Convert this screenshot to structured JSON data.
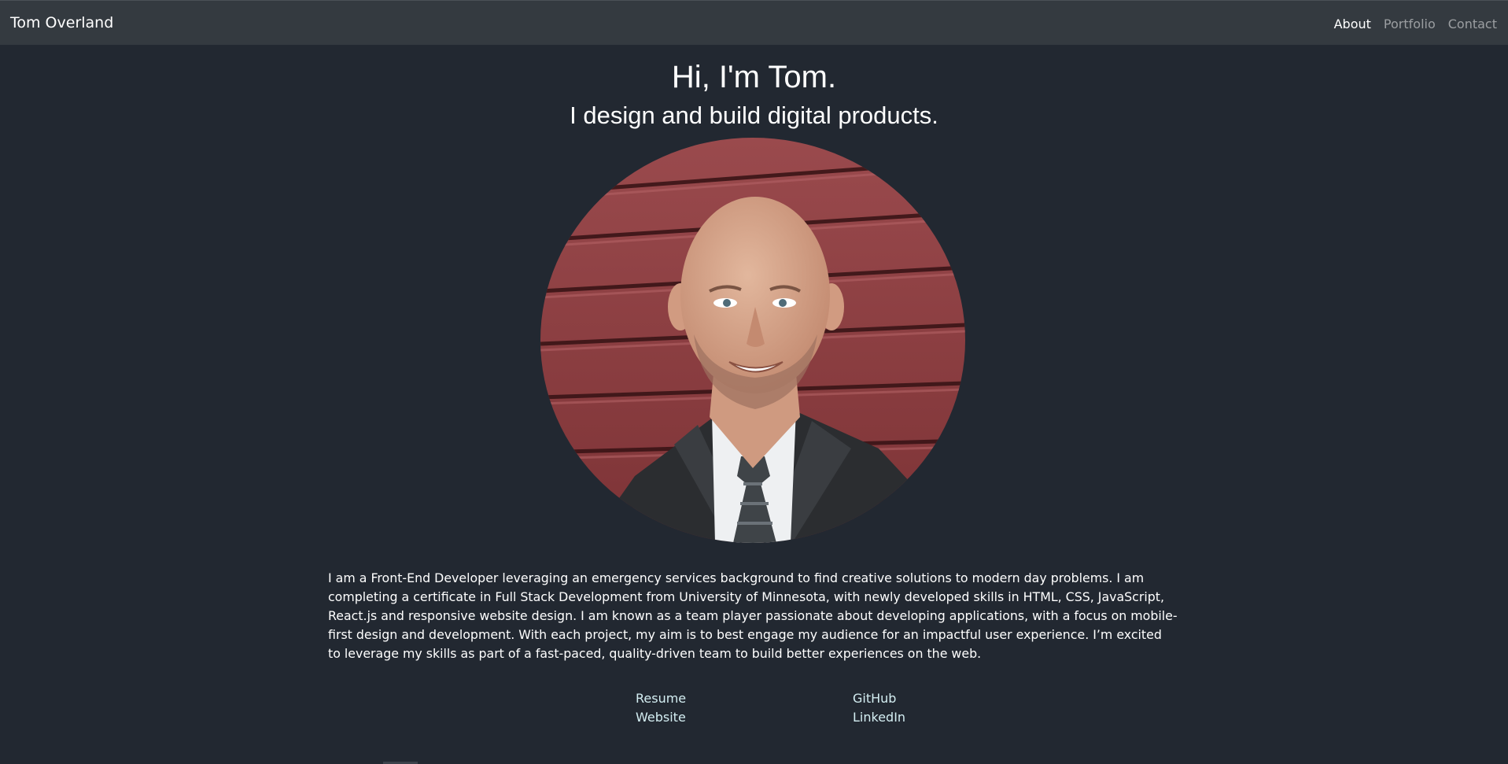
{
  "nav": {
    "brand": "Tom Overland",
    "links": [
      {
        "label": "About",
        "active": true
      },
      {
        "label": "Portfolio",
        "active": false
      },
      {
        "label": "Contact",
        "active": false
      }
    ]
  },
  "hero": {
    "title": "Hi, I'm Tom.",
    "subtitle": "I design and build digital products."
  },
  "bio": {
    "text": "I am a Front-End Developer leveraging an emergency services background to find creative solutions to modern day problems. I am completing a certificate in Full Stack Development from University of Minnesota, with newly developed skills in HTML, CSS, JavaScript, React.js and responsive website design. I am known as a team player passionate about developing applications, with a focus on mobile-first design and development. With each project, my aim is to best engage my audience for an impactful user experience. I’m excited to leverage my skills as part of a fast-paced, quality-driven team to build better experiences on the web."
  },
  "links": {
    "resume": "Resume",
    "github": "GitHub",
    "website": "Website",
    "linkedin": "LinkedIn"
  },
  "colors": {
    "page_background": "#222831",
    "navbar_background": "#343a40",
    "link_color": "#d4eef2",
    "siding_red": "#8e3f43"
  }
}
